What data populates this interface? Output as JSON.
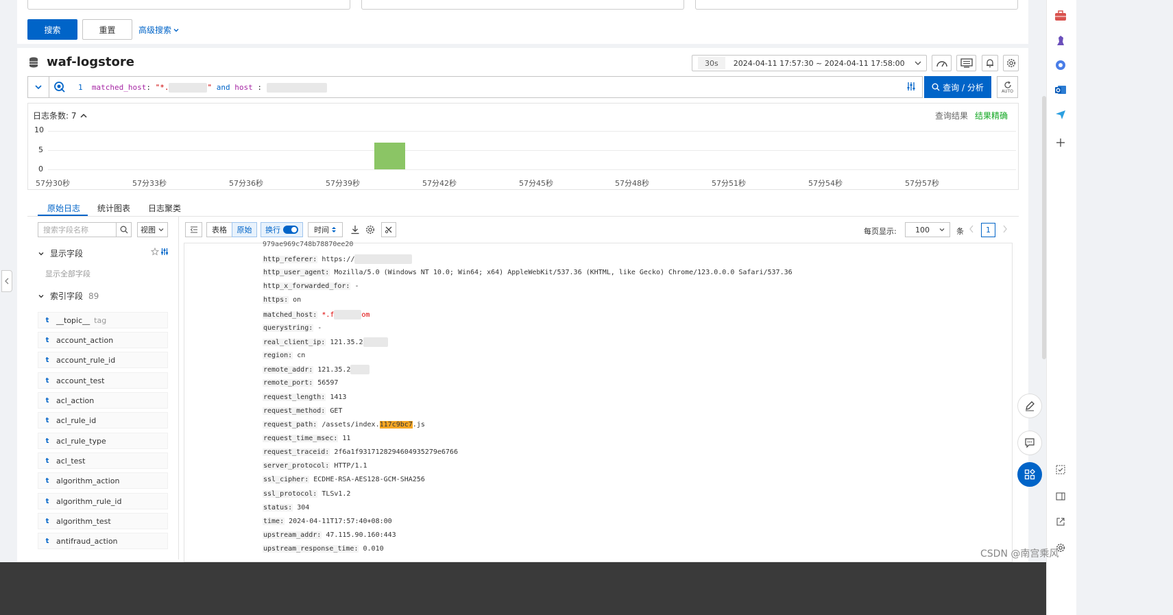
{
  "search_panel": {
    "search_button": "搜索",
    "reset_button": "重置",
    "advanced_search": "高级搜索"
  },
  "logstore": {
    "title": "waf-logstore"
  },
  "time_picker": {
    "refresh_interval": "30s",
    "range": "2024-04-11 17:57:30 ~ 2024-04-11 17:58:00"
  },
  "query": {
    "line_number": "1",
    "field1": "matched_host",
    "value1_prefix": "\"*.",
    "value1_suffix": "\"",
    "operator": "and",
    "field2": "host",
    "colon": ":",
    "run_button": "查询 / 分析",
    "auto_label": "AUTO"
  },
  "histogram": {
    "count_label": "日志条数: 7",
    "query_result": "查询结果",
    "result_exact": "结果精确",
    "y_ticks": [
      "10",
      "5",
      "0"
    ],
    "x_ticks": [
      "57分30秒",
      "57分33秒",
      "57分36秒",
      "57分39秒",
      "57分42秒",
      "57分45秒",
      "57分48秒",
      "57分51秒",
      "57分54秒",
      "57分57秒"
    ]
  },
  "chart_data": {
    "type": "bar",
    "x": [
      "57分40秒"
    ],
    "values": [
      7
    ],
    "ylim": [
      0,
      10
    ],
    "ylabel": "",
    "xlabel": ""
  },
  "tabs": [
    "原始日志",
    "统计图表",
    "日志聚类"
  ],
  "sidebar": {
    "search_placeholder": "搜索字段名称",
    "view_select": "视图",
    "display_fields": "显示字段",
    "show_all_fields": "显示全部字段",
    "index_fields": "索引字段",
    "index_count": "89",
    "fields": [
      {
        "type": "t",
        "name": "__topic__",
        "tag": "tag"
      },
      {
        "type": "t",
        "name": "account_action",
        "tag": ""
      },
      {
        "type": "t",
        "name": "account_rule_id",
        "tag": ""
      },
      {
        "type": "t",
        "name": "account_test",
        "tag": ""
      },
      {
        "type": "t",
        "name": "acl_action",
        "tag": ""
      },
      {
        "type": "t",
        "name": "acl_rule_id",
        "tag": ""
      },
      {
        "type": "t",
        "name": "acl_rule_type",
        "tag": ""
      },
      {
        "type": "t",
        "name": "acl_test",
        "tag": ""
      },
      {
        "type": "t",
        "name": "algorithm_action",
        "tag": ""
      },
      {
        "type": "t",
        "name": "algorithm_rule_id",
        "tag": ""
      },
      {
        "type": "t",
        "name": "algorithm_test",
        "tag": ""
      },
      {
        "type": "t",
        "name": "antifraud_action",
        "tag": ""
      }
    ]
  },
  "toolbar": {
    "table": "表格",
    "raw": "原始",
    "wrap": "换行",
    "time": "时间",
    "per_page_label": "每页显示:",
    "per_page_value": "100",
    "per_page_unit": "条",
    "page": "1"
  },
  "log": {
    "top_partial": "979ae969c748b7887‍0ee20",
    "lines": [
      {
        "key": "http_referer:",
        "value": "https://",
        "redact": 84
      },
      {
        "key": "http_user_agent:",
        "value": "Mozilla/5.0 (Windows NT 10.0; Win64; x64) AppleWebKit/537.36 (KHTML, like Gecko) Chrome/123.0.0.0 Safari/537.36",
        "redact": 0
      },
      {
        "key": "http_x_forwarded_for:",
        "value": "-",
        "redact": 0
      },
      {
        "key": "https:",
        "value": "on",
        "redact": 0
      },
      {
        "key": "matched_host:",
        "value": "*.f",
        "value_suffix": "om",
        "redact": 40,
        "red": true
      },
      {
        "key": "querystring:",
        "value": "-",
        "redact": 0
      },
      {
        "key": "real_client_ip:",
        "value": "121.35.2",
        "redact": 36
      },
      {
        "key": "region:",
        "value": "cn",
        "redact": 0
      },
      {
        "key": "remote_addr:",
        "value": "121.35.2",
        "redact": 28
      },
      {
        "key": "remote_port:",
        "value": "56597",
        "redact": 0
      },
      {
        "key": "request_length:",
        "value": "1413",
        "redact": 0
      },
      {
        "key": "request_method:",
        "value": "GET",
        "redact": 0
      },
      {
        "key": "request_path:",
        "value": "/assets/index.",
        "highlight": "117c9bc7",
        "value_suffix": ".js",
        "redact": 0
      },
      {
        "key": "request_time_msec:",
        "value": "11",
        "redact": 0
      },
      {
        "key": "request_traceid:",
        "value": "2f6a1f9317128294604935279e6766",
        "redact": 0
      },
      {
        "key": "server_protocol:",
        "value": "HTTP/1.1",
        "redact": 0
      },
      {
        "key": "ssl_cipher:",
        "value": "ECDHE-RSA-AES128-GCM-SHA256",
        "redact": 0
      },
      {
        "key": "ssl_protocol:",
        "value": "TLSv1.2",
        "redact": 0
      },
      {
        "key": "status:",
        "value": "304",
        "redact": 0
      },
      {
        "key": "time:",
        "value": "2024-04-11T17:57:40+08:00",
        "redact": 0
      },
      {
        "key": "upstream_addr:",
        "value": "47.115.90.160:443",
        "redact": 0
      },
      {
        "key": "upstream_response_time:",
        "value": "0.010",
        "redact": 0
      }
    ]
  },
  "watermark": "CSDN @南宫乘风",
  "colors": {
    "primary": "#0064c8",
    "bar": "#8bc565",
    "success": "#14a824",
    "highlight": "#f5a623"
  }
}
